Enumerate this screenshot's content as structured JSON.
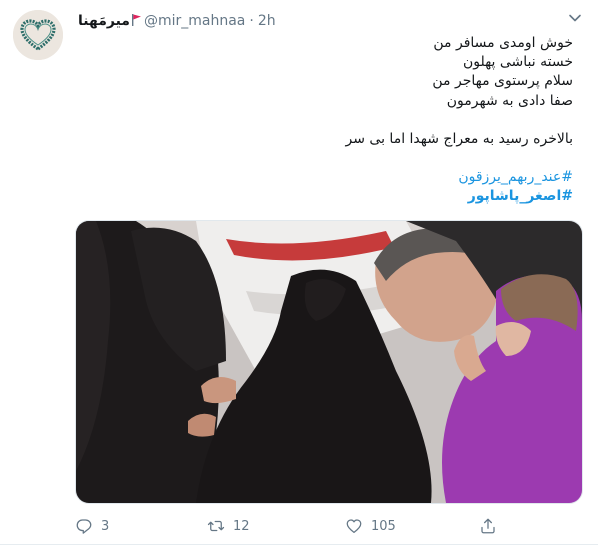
{
  "tweet": {
    "display_name": "میرمَهنا",
    "handle": "@mir_mahnaa",
    "separator": "·",
    "time": "2h",
    "lines": [
      "خوش اومدی مسافر من",
      "خسته نباشی پهلون",
      "سلام پرستوی مهاجر من",
      "صفا دادی به شهرمون"
    ],
    "line_after_break": "بالاخره رسید به معراج شهدا اما بی سر",
    "hashtags": [
      "#عند_ربهم_یرزقون",
      "#اصغر_پاشاپور"
    ],
    "image_alt": "Mourners in black chadors and a man bowing his head over a flag-draped coffin"
  },
  "actions": {
    "reply_count": "3",
    "retweet_count": "12",
    "like_count": "105"
  },
  "colors": {
    "text": "#14171a",
    "secondary": "#657786",
    "link": "#1b95e0",
    "flag": "#e0245e"
  },
  "icons": {
    "avatar": "heart-avatar",
    "flag": "red-flag-icon",
    "menu": "chevron-down-icon",
    "reply": "reply-icon",
    "retweet": "retweet-icon",
    "like": "heart-icon",
    "share": "share-icon"
  }
}
